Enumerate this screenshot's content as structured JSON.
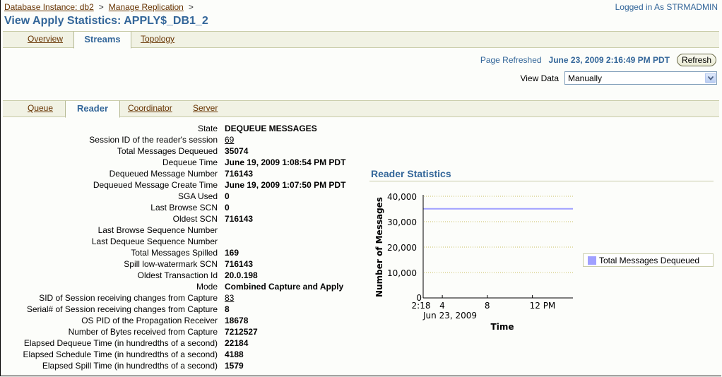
{
  "header": {
    "breadcrumb": [
      {
        "label": "Database Instance: db2"
      },
      {
        "label": "Manage Replication"
      }
    ],
    "breadcrumb_separator": ">",
    "login": "Logged in As STRMADMIN",
    "title": "View Apply Statistics: APPLY$_DB1_2"
  },
  "main_tabs": [
    {
      "label": "Overview",
      "active": false
    },
    {
      "label": "Streams",
      "active": true
    },
    {
      "label": "Topology",
      "active": false
    }
  ],
  "refresh": {
    "label": "Page Refreshed",
    "value": "June 23, 2009 2:16:49 PM PDT",
    "button": "Refresh"
  },
  "view_data": {
    "label": "View Data",
    "selected": "Manually"
  },
  "sub_tabs": [
    {
      "label": "Queue",
      "active": false
    },
    {
      "label": "Reader",
      "active": true
    },
    {
      "label": "Coordinator",
      "active": false
    },
    {
      "label": "Server",
      "active": false
    }
  ],
  "properties": [
    {
      "label": "State",
      "value": "DEQUEUE MESSAGES"
    },
    {
      "label": "Session ID of the reader's session",
      "value": "69",
      "link": true
    },
    {
      "label": "Total Messages Dequeued",
      "value": "35074"
    },
    {
      "label": "Dequeue Time",
      "value": "June 19, 2009 1:08:54 PM PDT"
    },
    {
      "label": "Dequeued Message Number",
      "value": "716143"
    },
    {
      "label": "Dequeued Message Create Time",
      "value": "June 19, 2009 1:07:50 PM PDT"
    },
    {
      "label": "SGA Used",
      "value": "0"
    },
    {
      "label": "Last Browse SCN",
      "value": "0"
    },
    {
      "label": "Oldest SCN",
      "value": "716143"
    },
    {
      "label": "Last Browse Sequence Number",
      "value": ""
    },
    {
      "label": "Last Dequeue Sequence Number",
      "value": ""
    },
    {
      "label": "Total Messages Spilled",
      "value": "169"
    },
    {
      "label": "Spill low-watermark SCN",
      "value": "716143"
    },
    {
      "label": "Oldest Transaction Id",
      "value": "20.0.198"
    },
    {
      "label": "Mode",
      "value": "Combined Capture and Apply"
    },
    {
      "label": "SID of Session receiving changes from Capture",
      "value": "83",
      "link": true
    },
    {
      "label": "Serial# of Session receiving changes from Capture",
      "value": "8"
    },
    {
      "label": "OS PID of the Propagation Receiver",
      "value": "18678"
    },
    {
      "label": "Number of Bytes received from Capture",
      "value": "7212527"
    },
    {
      "label": "Elapsed Dequeue Time (in hundredths of a second)",
      "value": "22184"
    },
    {
      "label": "Elapsed Schedule Time (in hundredths of a second)",
      "value": "4188"
    },
    {
      "label": "Elapsed Spill Time (in hundredths of a second)",
      "value": "1579"
    }
  ],
  "chart_section": {
    "title": "Reader Statistics"
  },
  "chart_data": {
    "type": "line",
    "title": "Reader Statistics",
    "xlabel": "Time",
    "ylabel": "Number of Messages",
    "ylim": [
      0,
      40000
    ],
    "yticks": [
      0,
      10000,
      20000,
      30000,
      40000
    ],
    "ytick_labels": [
      "0",
      "10,000",
      "20,000",
      "30,000",
      "40,000"
    ],
    "x_range_hours": [
      2.3,
      15.6
    ],
    "xticks": [
      {
        "hour": 2.3,
        "label": "2:18"
      },
      {
        "hour": 4,
        "label": "4"
      },
      {
        "hour": 8,
        "label": "8"
      },
      {
        "hour": 12,
        "label": "12 PM"
      }
    ],
    "x_date_label": "Jun 23, 2009",
    "grid": true,
    "legend_position": "right",
    "series": [
      {
        "name": "Total Messages Dequeued",
        "color": "#a0a0ff",
        "points": [
          {
            "hour": 2.3,
            "value": 35074
          },
          {
            "hour": 15.6,
            "value": 35074
          }
        ]
      }
    ]
  }
}
